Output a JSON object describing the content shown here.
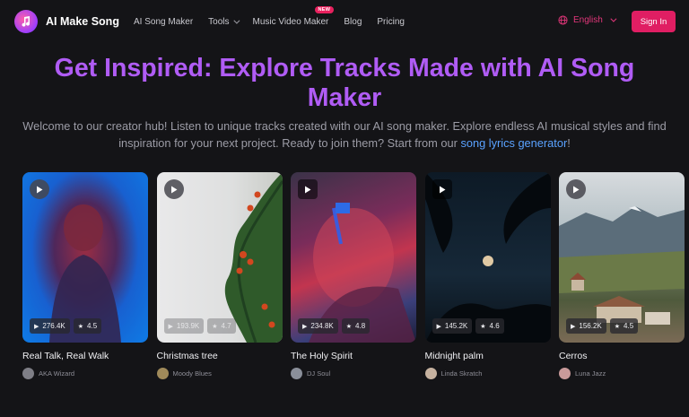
{
  "nav": {
    "brand": "AI Make Song",
    "links": [
      {
        "label": "AI Song Maker"
      },
      {
        "label": "Tools"
      },
      {
        "label": "Music Video Maker",
        "badge": "NEW"
      },
      {
        "label": "Blog"
      },
      {
        "label": "Pricing"
      }
    ],
    "language": "English",
    "signin": "Sign In"
  },
  "hero": {
    "title": "Get Inspired: Explore Tracks Made with AI Song Maker",
    "subtitle_pre": "Welcome to our creator hub! Listen to unique tracks created with our AI song maker. Explore endless AI musical styles and find inspiration for your next project. Ready to join them? Start from our ",
    "subtitle_link": "song lyrics generator",
    "subtitle_post": "!"
  },
  "tracks": [
    {
      "title": "Real Talk, Real Walk",
      "plays": "276.4K",
      "rating": "4.5",
      "artist": "AKA Wizard"
    },
    {
      "title": "Christmas tree",
      "plays": "193.9K",
      "rating": "4.7",
      "artist": "Moody Blues"
    },
    {
      "title": "The Holy Spirit",
      "plays": "234.8K",
      "rating": "4.8",
      "artist": "DJ Soul"
    },
    {
      "title": "Midnight palm",
      "plays": "145.2K",
      "rating": "4.6",
      "artist": "Linda Skratch"
    },
    {
      "title": "Cerros",
      "plays": "156.2K",
      "rating": "4.5",
      "artist": "Luna Jazz"
    }
  ],
  "colors": {
    "accent_pink": "#e01e63",
    "title_purple": "#b05cf5",
    "link_blue": "#5aa2ff",
    "background": "#141417"
  },
  "icons": [
    "logo-icon",
    "chevron-down-icon",
    "globe-icon",
    "play-icon",
    "play-count-icon",
    "star-icon"
  ]
}
